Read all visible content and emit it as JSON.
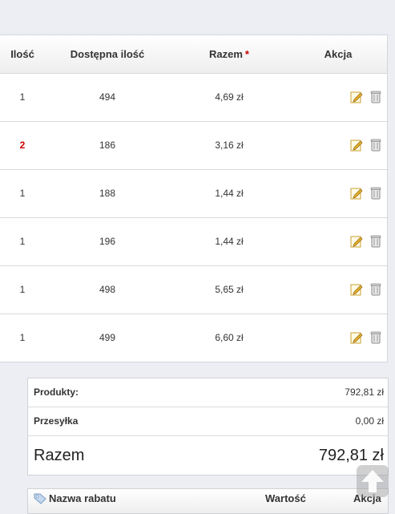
{
  "table": {
    "headers": {
      "qty": "Ilość",
      "available": "Dostępna ilość",
      "total": "Razem",
      "total_marker": "*",
      "action": "Akcja"
    },
    "rows": [
      {
        "qty": "1",
        "available": "494",
        "total": "4,69 zł",
        "qty_warning": false
      },
      {
        "qty": "2",
        "available": "186",
        "total": "3,16 zł",
        "qty_warning": true
      },
      {
        "qty": "1",
        "available": "188",
        "total": "1,44 zł",
        "qty_warning": false
      },
      {
        "qty": "1",
        "available": "196",
        "total": "1,44 zł",
        "qty_warning": false
      },
      {
        "qty": "1",
        "available": "498",
        "total": "5,65 zł",
        "qty_warning": false
      },
      {
        "qty": "1",
        "available": "499",
        "total": "6,60 zł",
        "qty_warning": false
      }
    ],
    "action_icons": [
      "edit-pencil-icon",
      "trash-bin-icon"
    ]
  },
  "totals": {
    "products_label": "Produkty:",
    "products_value": "792,81 zł",
    "shipping_label": "Przesyłka",
    "shipping_value": "0,00 zł",
    "total_label": "Razem",
    "total_value": "792,81 zł"
  },
  "discounts": {
    "name_header": "Nazwa rabatu",
    "value_header": "Wartość",
    "action_header": "Akcja",
    "icon": "tag-icon"
  },
  "colors": {
    "warning": "#cc0000",
    "page_background": "#eceef4",
    "pencil": "#e6b12d",
    "trash": "#8a8a8a"
  }
}
